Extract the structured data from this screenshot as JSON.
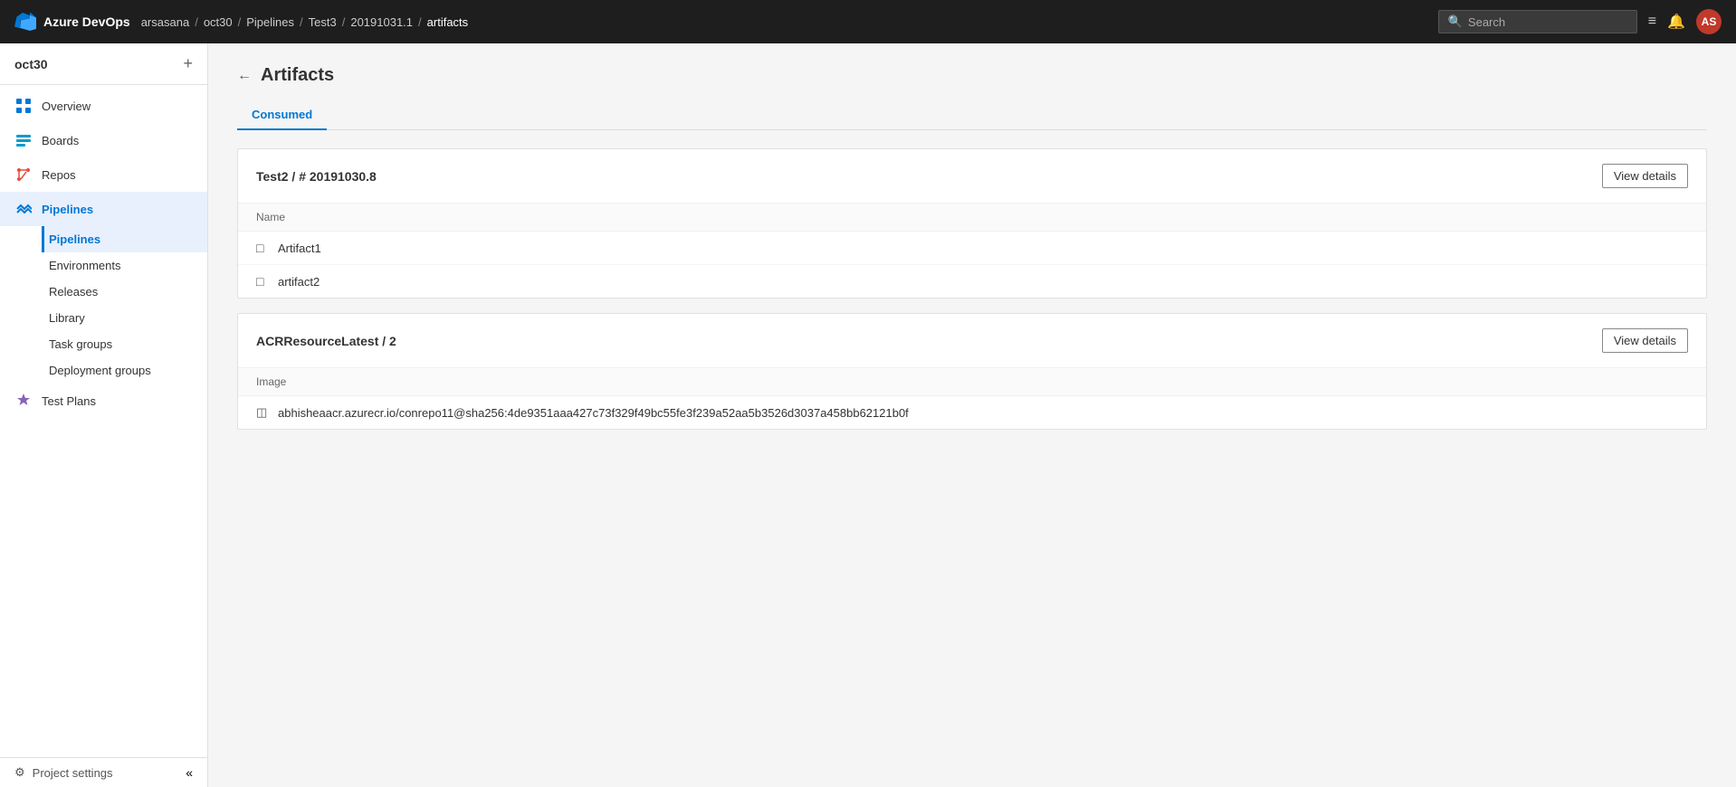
{
  "topbar": {
    "logo_text": "Azure DevOps",
    "breadcrumbs": [
      {
        "label": "arsasana",
        "sep": "/"
      },
      {
        "label": "oct30",
        "sep": "/"
      },
      {
        "label": "Pipelines",
        "sep": "/"
      },
      {
        "label": "Test3",
        "sep": "/"
      },
      {
        "label": "20191031.1",
        "sep": "/"
      },
      {
        "label": "artifacts",
        "sep": ""
      }
    ],
    "search_placeholder": "Search",
    "avatar_initials": "AS"
  },
  "sidebar": {
    "project_name": "oct30",
    "nav_items": [
      {
        "id": "overview",
        "label": "Overview",
        "icon": "overview"
      },
      {
        "id": "boards",
        "label": "Boards",
        "icon": "boards"
      },
      {
        "id": "repos",
        "label": "Repos",
        "icon": "repos"
      },
      {
        "id": "pipelines",
        "label": "Pipelines",
        "icon": "pipelines"
      }
    ],
    "pipelines_sub": [
      {
        "id": "pipelines-sub",
        "label": "Pipelines",
        "active": true
      },
      {
        "id": "environments",
        "label": "Environments"
      },
      {
        "id": "releases",
        "label": "Releases"
      },
      {
        "id": "library",
        "label": "Library"
      },
      {
        "id": "task-groups",
        "label": "Task groups"
      },
      {
        "id": "deployment-groups",
        "label": "Deployment groups"
      }
    ],
    "test_plans": {
      "label": "Test Plans",
      "icon": "test-plans"
    },
    "footer": {
      "project_settings_label": "Project settings",
      "collapse_icon": "«"
    }
  },
  "page": {
    "title": "Artifacts",
    "back_label": "←",
    "tabs": [
      {
        "id": "consumed",
        "label": "Consumed",
        "active": true
      }
    ]
  },
  "cards": [
    {
      "id": "card1",
      "title": "Test2 / # 20191030.8",
      "view_details_label": "View details",
      "section_label": "Name",
      "rows": [
        {
          "icon": "artifact",
          "text": "Artifact1"
        },
        {
          "icon": "artifact",
          "text": "artifact2"
        }
      ]
    },
    {
      "id": "card2",
      "title": "ACRResourceLatest / 2",
      "view_details_label": "View details",
      "section_label": "Image",
      "rows": [
        {
          "icon": "container",
          "text": "abhisheaacr.azurecr.io/conrepo11@sha256:4de9351aaa427c73f329f49bc55fe3f239a52aa5b3526d3037a458bb62121b0f"
        }
      ]
    }
  ]
}
